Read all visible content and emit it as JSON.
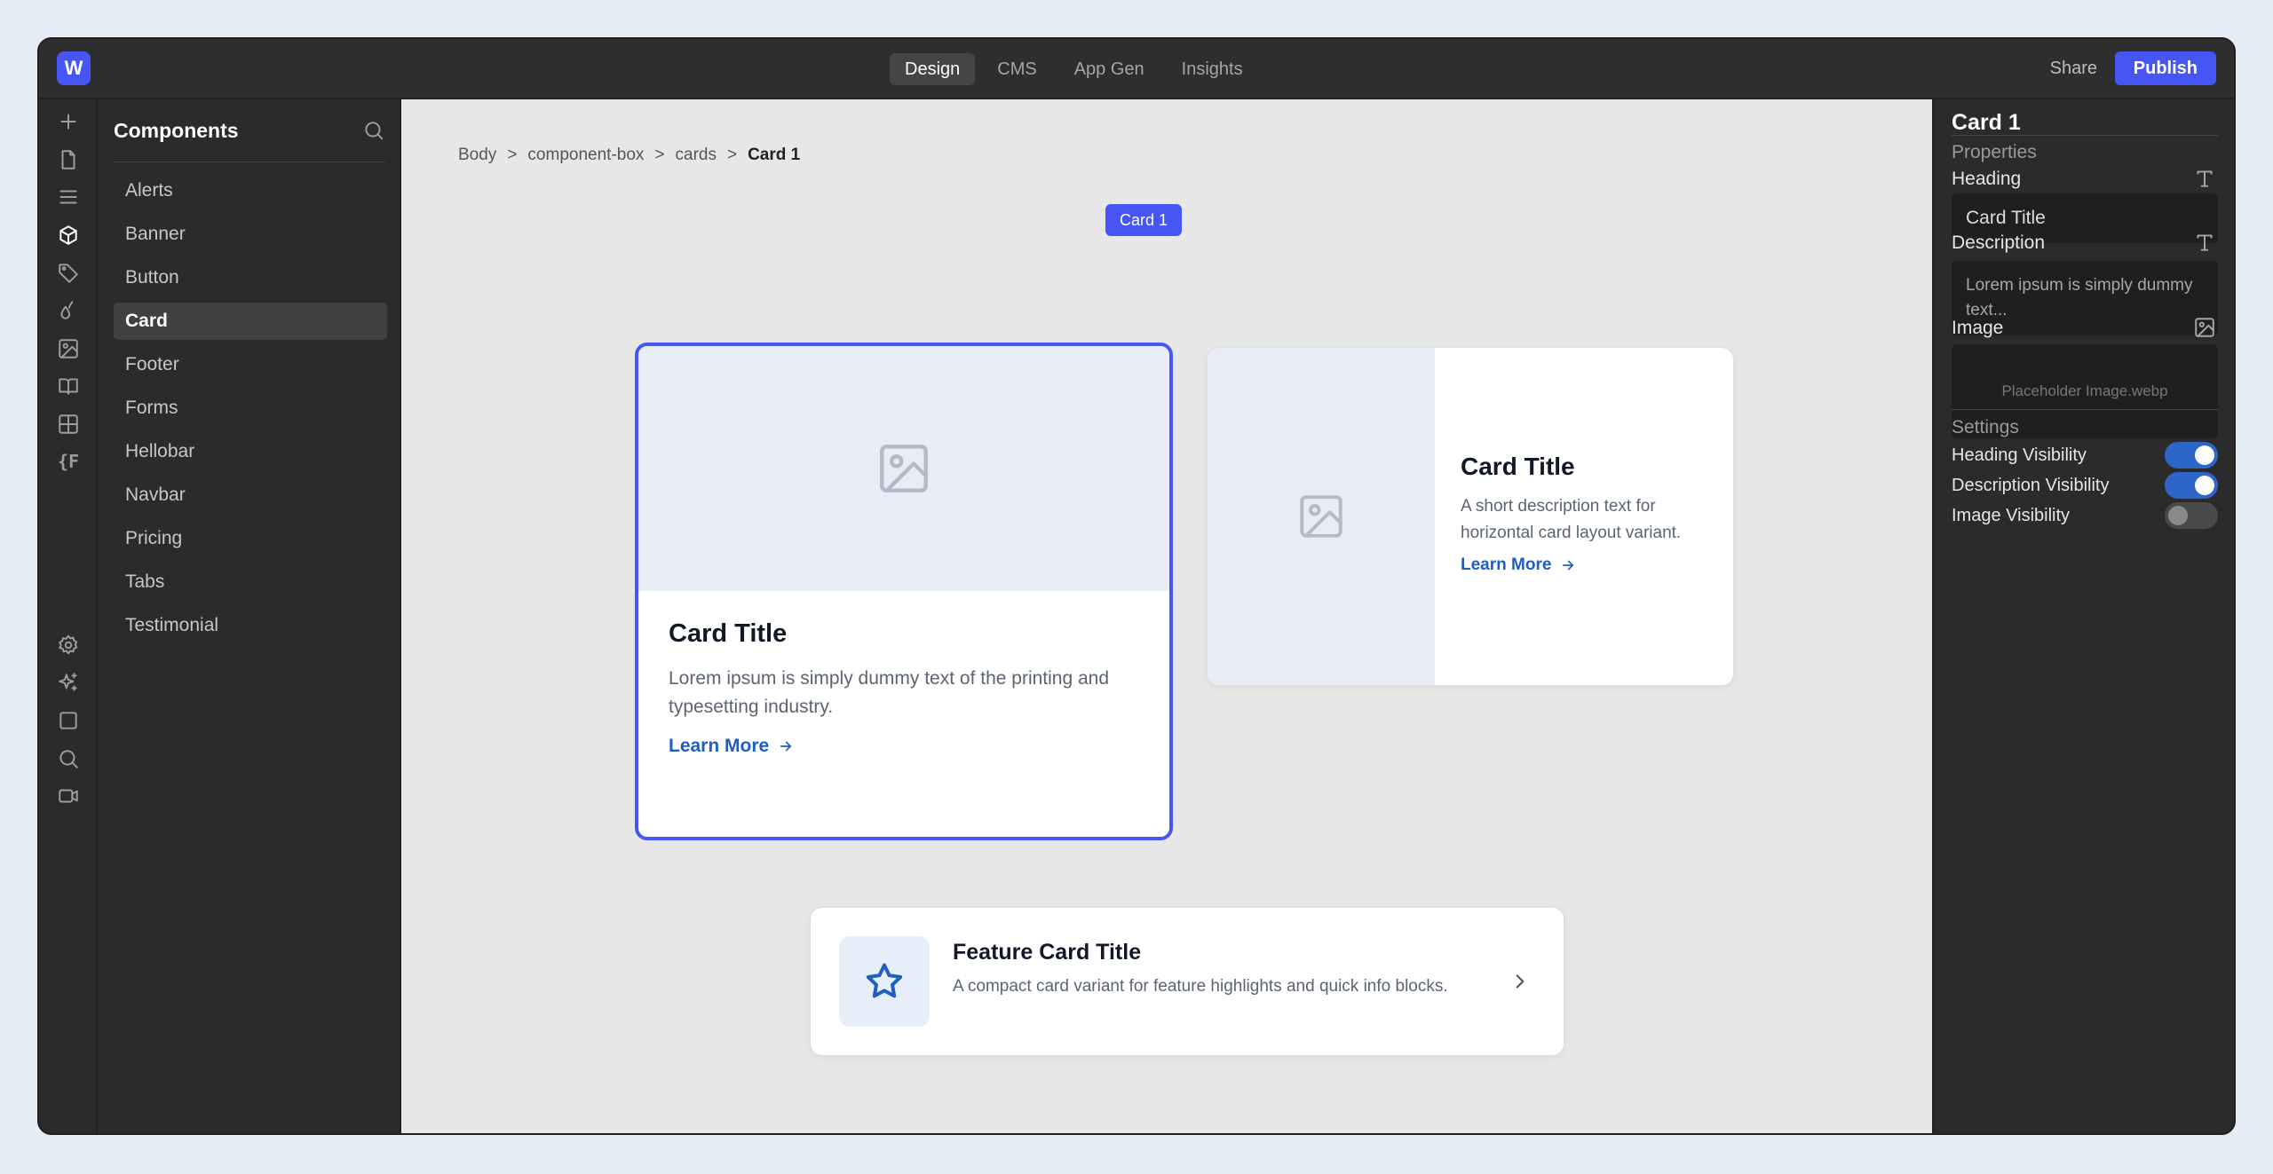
{
  "topbar": {
    "logo_letter": "W",
    "tabs": [
      {
        "label": "Design",
        "active": true
      },
      {
        "label": "CMS",
        "active": false
      },
      {
        "label": "App Gen",
        "active": false
      },
      {
        "label": "Insights",
        "active": false
      }
    ],
    "share_label": "Share",
    "publish_label": "Publish",
    "accent_color": "#4655f4"
  },
  "rail": {
    "items": [
      {
        "icon": "plus-icon"
      },
      {
        "icon": "page-icon"
      },
      {
        "icon": "menu-icon"
      },
      {
        "icon": "cube-icon",
        "active": true
      },
      {
        "icon": "tag-icon"
      },
      {
        "icon": "drops-icon"
      },
      {
        "icon": "image-icon"
      },
      {
        "icon": "book-icon"
      },
      {
        "icon": "grid-icon"
      },
      {
        "icon": "variables-icon",
        "text": "{F"
      },
      {
        "icon": "settings-icon"
      },
      {
        "icon": "sparkle-icon"
      },
      {
        "icon": "square-icon"
      },
      {
        "icon": "search-icon"
      },
      {
        "icon": "video-icon"
      }
    ]
  },
  "components_panel": {
    "title": "Components",
    "items": [
      {
        "label": "Alerts"
      },
      {
        "label": "Banner"
      },
      {
        "label": "Button"
      },
      {
        "label": "Card",
        "active": true
      },
      {
        "label": "Footer"
      },
      {
        "label": "Forms"
      },
      {
        "label": "Hellobar"
      },
      {
        "label": "Navbar"
      },
      {
        "label": "Pricing"
      },
      {
        "label": "Tabs"
      },
      {
        "label": "Testimonial"
      }
    ]
  },
  "canvas": {
    "breadcrumb": [
      "Body",
      "component-box",
      "cards",
      "Card 1"
    ],
    "breadcrumb_separator": ">",
    "selection_badge": "Card 1",
    "card1": {
      "title": "Card Title",
      "description": "Lorem ipsum is simply dummy text of the printing and typesetting industry.",
      "link": "Learn More"
    },
    "card2": {
      "title": "Card Title",
      "description": "A short description text for horizontal card layout variant.",
      "link": "Learn More"
    },
    "feature_card": {
      "title": "Feature Card Title",
      "description": "A compact card variant for feature highlights and quick info blocks.",
      "icon": "star-icon"
    }
  },
  "properties_panel": {
    "title": "Card 1",
    "properties_label": "Properties",
    "heading_label": "Heading",
    "heading_value": "Card Title",
    "description_label": "Description",
    "description_value": "Lorem ipsum is simply dummy text...",
    "image_label": "Image",
    "image_value": "Placeholder Image.webp",
    "settings_label": "Settings",
    "toggles": [
      {
        "label": "Heading Visibility",
        "on": true
      },
      {
        "label": "Description Visibility",
        "on": true
      },
      {
        "label": "Image Visibility",
        "on": false
      }
    ]
  }
}
